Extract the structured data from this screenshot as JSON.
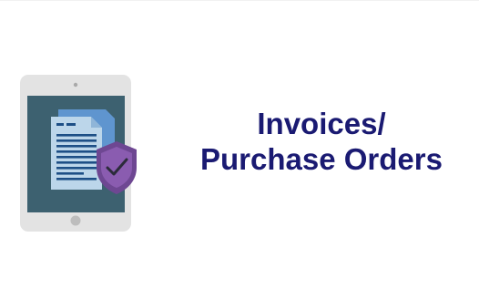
{
  "icon": {
    "name": "tablet-document-shield-icon",
    "device_color": "#e3e3e3",
    "screen_color": "#3d6170",
    "document_color": "#bcd6ea",
    "document_back_color": "#5f95cf",
    "text_line_color": "#1d4f86",
    "shield_color": "#6e4792",
    "check_color": "#2b2b3a"
  },
  "title": {
    "line1": "Invoices/",
    "line2": "Purchase Orders",
    "color": "#1a1a72"
  }
}
